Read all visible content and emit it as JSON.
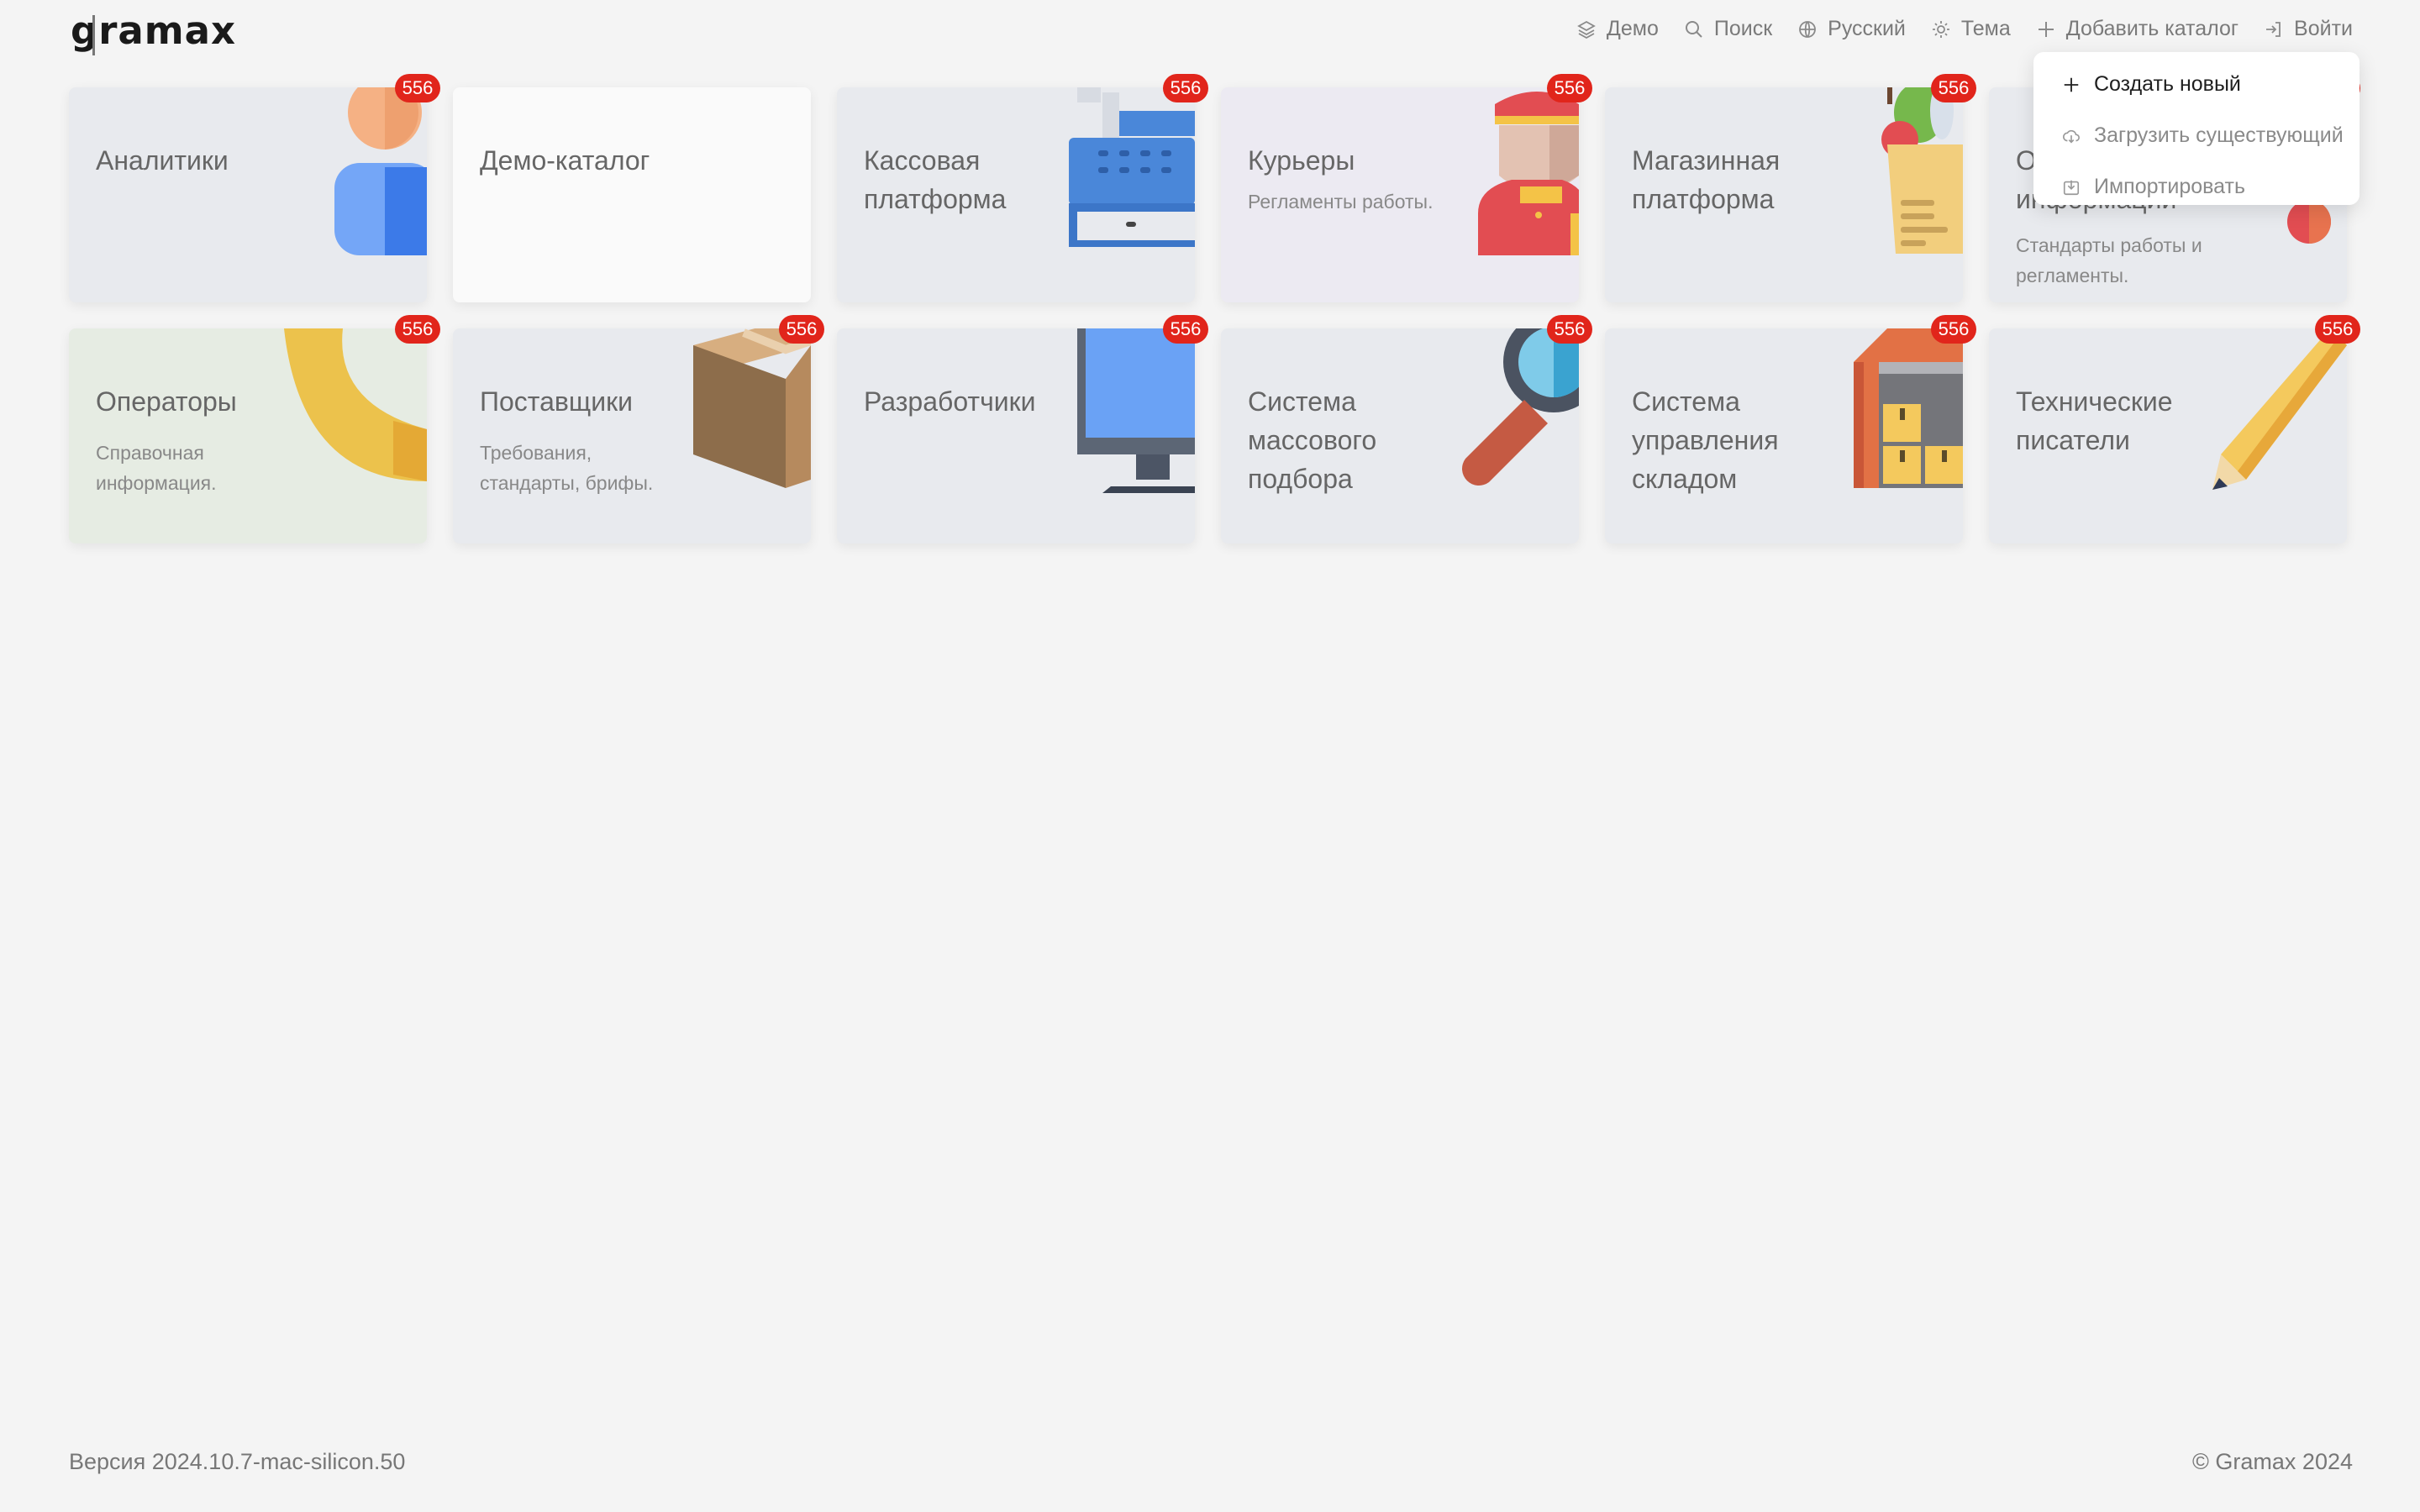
{
  "app": {
    "logo": "gramax"
  },
  "topnav": {
    "demo": "Демо",
    "search": "Поиск",
    "language": "Русский",
    "theme": "Тема",
    "add_catalog": "Добавить каталог",
    "login": "Войти"
  },
  "dropdown": {
    "create": "Создать новый",
    "load": "Загрузить существующий",
    "import": "Импортировать"
  },
  "cards": [
    {
      "title": "Аналитики",
      "desc": "",
      "badge": "556",
      "icon": "user-icon"
    },
    {
      "title": "Демо-каталог",
      "desc": "",
      "badge": "",
      "icon": ""
    },
    {
      "title": "Кассовая платформа",
      "desc": "",
      "badge": "556",
      "icon": "cash-register-icon"
    },
    {
      "title": "Курьеры",
      "desc": "Регламенты работы.",
      "badge": "556",
      "icon": "courier-icon"
    },
    {
      "title": "Магазинная платформа",
      "desc": "",
      "badge": "556",
      "icon": "grocery-bag-icon"
    },
    {
      "title": "О... информации",
      "desc": "Стандарты работы и регламенты.",
      "badge": "556",
      "icon": "info-icon"
    },
    {
      "title": "Операторы",
      "desc": "Справочная информация.",
      "badge": "556",
      "icon": "phone-icon"
    },
    {
      "title": "Поставщики",
      "desc": "Требования, стандарты, брифы.",
      "badge": "556",
      "icon": "box-icon"
    },
    {
      "title": "Разработчики",
      "desc": "",
      "badge": "556",
      "icon": "monitor-icon"
    },
    {
      "title": "Система массового подбора",
      "desc": "",
      "badge": "556",
      "icon": "magnifier-icon"
    },
    {
      "title": "Система управления складом",
      "desc": "",
      "badge": "556",
      "icon": "warehouse-icon"
    },
    {
      "title": "Технические писатели",
      "desc": "",
      "badge": "556",
      "icon": "pencil-icon"
    }
  ],
  "footer": {
    "version": "Версия 2024.10.7-mac-silicon.50",
    "copyright": "© Gramax 2024"
  }
}
